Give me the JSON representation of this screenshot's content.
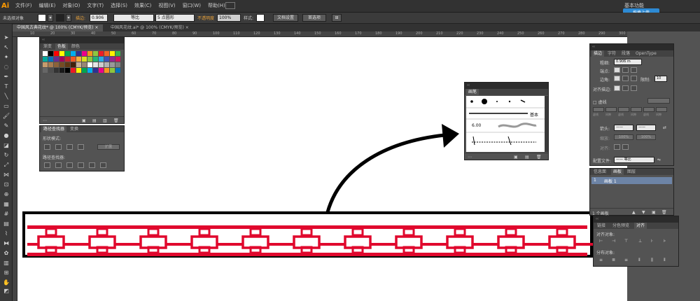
{
  "app": {
    "logo": "Ai",
    "workspace": "基本功能"
  },
  "menu": {
    "items": [
      "文件(F)",
      "编辑(E)",
      "对象(O)",
      "文字(T)",
      "选择(S)",
      "效果(C)",
      "视图(V)",
      "窗口(W)",
      "帮助(H)"
    ]
  },
  "control": {
    "selection_label": "未选择对象",
    "stroke_label": "描边:",
    "stroke_value": "0.906",
    "profile_label": "等比",
    "brush_label": "5 点圆形",
    "opacity_label": "不透明度",
    "opacity_value": "100%",
    "style_label": "样式:",
    "doc_setup": "文档设置",
    "prefs": "首选项",
    "cloud_sync": "拖拽上传"
  },
  "tabs": [
    {
      "label": "中国风古典花纹* @ 100% (CMYK/预览)",
      "close": "×"
    },
    {
      "label": "中国风花纹.ai* @ 100% (CMYK/预览)",
      "close": "×"
    }
  ],
  "ruler": {
    "ticks": [
      "10",
      "20",
      "30",
      "40",
      "50",
      "60",
      "70",
      "80",
      "90",
      "100",
      "110",
      "120",
      "130",
      "140",
      "150",
      "160",
      "170",
      "180",
      "190",
      "200",
      "210",
      "220",
      "230",
      "240",
      "250",
      "260",
      "270",
      "280",
      "290",
      "300"
    ]
  },
  "swatches_panel": {
    "tabs": [
      "渐变",
      "色板",
      "颜色"
    ],
    "colors": [
      "#ffffff",
      "#000000",
      "#ff0000",
      "#ffff00",
      "#00a651",
      "#00aeef",
      "#2e3192",
      "#ec008c",
      "#f7941d",
      "#8dc63f",
      "#ed1c24",
      "#f26522",
      "#fff200",
      "#39b54a",
      "#00a99d",
      "#0072bc",
      "#662d91",
      "#9e005d",
      "#c1272d",
      "#f15a24",
      "#fbb03b",
      "#d9e021",
      "#8cc63f",
      "#22b573",
      "#29abe2",
      "#3f51b5",
      "#93278f",
      "#d4145a",
      "#c69c6d",
      "#a67c52",
      "#8c6239",
      "#754c24",
      "#603813",
      "#42210b",
      "#c7b299",
      "#998675",
      "#ffffff",
      "#e6e6e6",
      "#cccccc",
      "#b3b3b3",
      "#999999",
      "#808080",
      "#666666",
      "#4d4d4d",
      "#333333",
      "#1a1a1a",
      "#000000",
      "#ed1c24",
      "#fff200",
      "#00a651",
      "#00aeef",
      "#2e3192",
      "#ec008c",
      "#f7941d",
      "#8dc63f",
      "#0072bc"
    ]
  },
  "pathfinder_panel": {
    "tabs": [
      "路径查找器",
      "变换"
    ],
    "shape_modes_label": "形状模式:",
    "expand_label": "扩展",
    "pathfinders_label": "路径查找器:"
  },
  "brush_panel": {
    "title": "画笔",
    "basic_label": "基本",
    "size_value": "6.00"
  },
  "stroke_panel": {
    "tabs": [
      "描边",
      "字符",
      "段落",
      "OpenType"
    ],
    "weight_label": "粗细:",
    "weight_value": "0.906 m",
    "cap_label": "端点:",
    "corner_label": "边角:",
    "limit_label": "限制:",
    "limit_value": "10",
    "align_label": "对齐描边:",
    "dashed_label": "虚线",
    "dash_labels": [
      "虚线",
      "间隙",
      "虚线",
      "间隙",
      "虚线",
      "间隙"
    ],
    "arrow_label": "箭头:",
    "scale_label": "缩放:",
    "scale_value_1": "100%",
    "scale_value_2": "100%",
    "align_arrow_label": "对齐:",
    "profile_label": "配置文件:",
    "profile_value": "等比"
  },
  "artboards_panel": {
    "tabs": [
      "信息面",
      "画板",
      "图层"
    ],
    "row_number": "1",
    "row_name": "画板 1",
    "count_label": "1 个画板"
  },
  "align_panel": {
    "tabs": [
      "链接",
      "分色预览",
      "对齐"
    ],
    "align_objects_label": "对齐对象:",
    "distribute_label": "分布对象:"
  },
  "colors": {
    "red": "#e0082d",
    "accent": "#2d8ad4",
    "panel": "#535353"
  }
}
